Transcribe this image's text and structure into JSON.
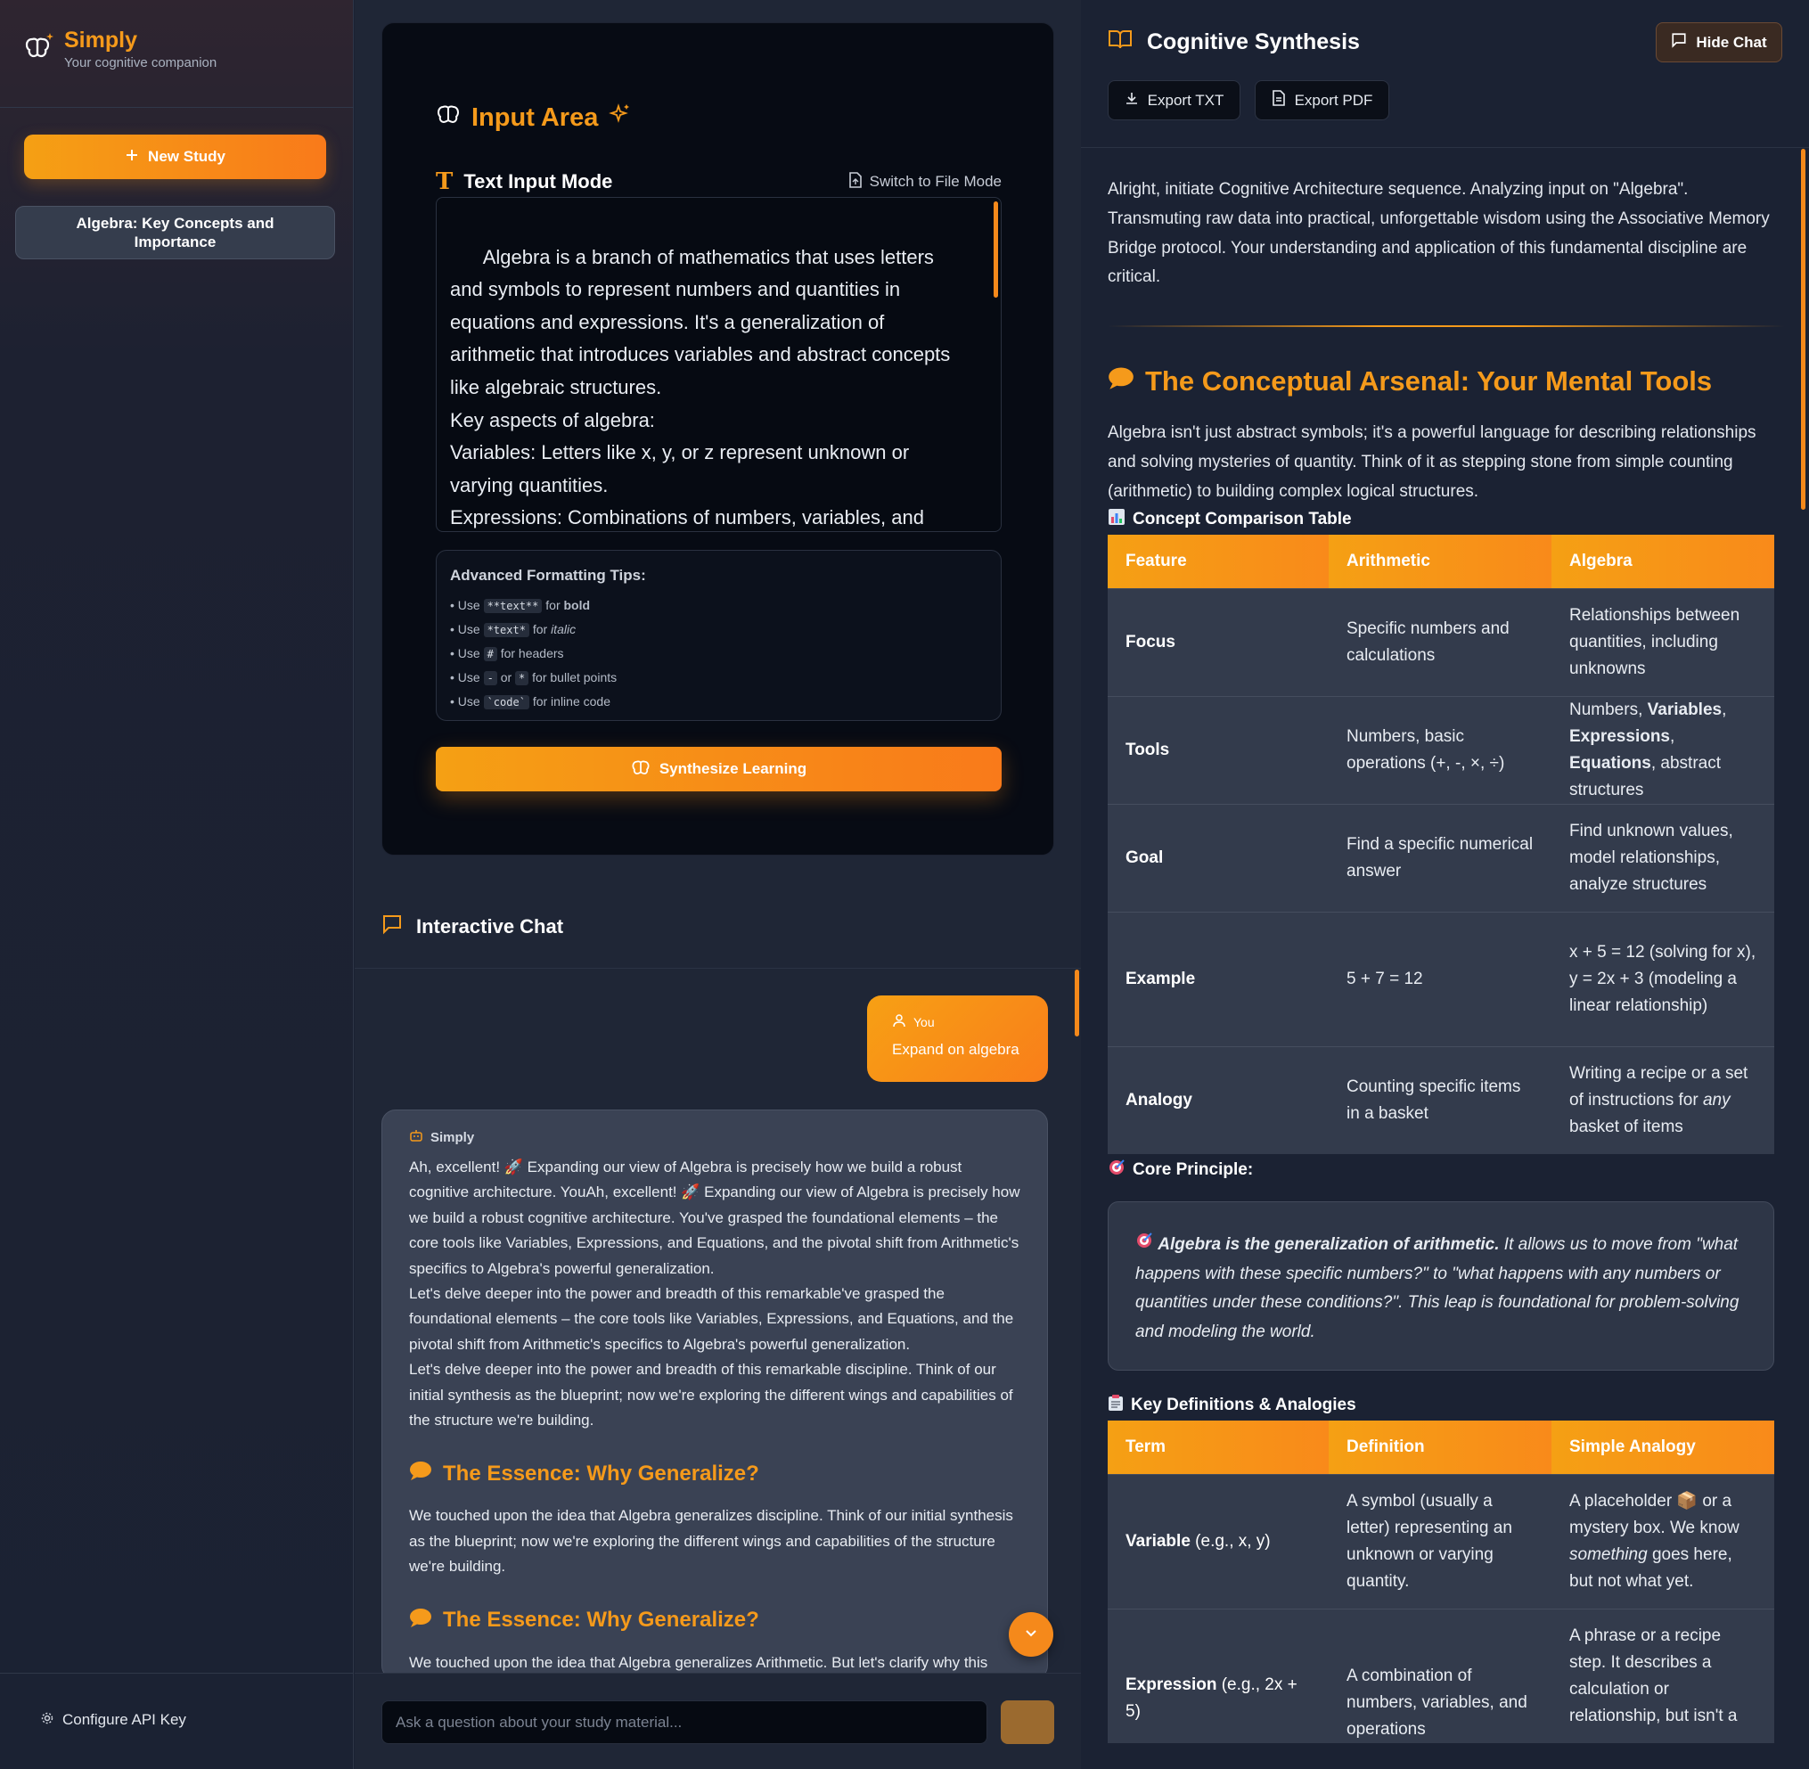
{
  "sidebar": {
    "app_name": "Simply",
    "tagline": "Your cognitive companion",
    "new_study": "New Study",
    "study_item": "Algebra: Key Concepts and Importance",
    "config": "Configure API Key"
  },
  "input": {
    "title": "Input Area",
    "mode": "Text Input Mode",
    "switch": "Switch to File Mode",
    "text": "Algebra is a branch of mathematics that uses letters and symbols to represent numbers and quantities in equations and expressions. It's a generalization of arithmetic that introduces variables and abstract concepts like algebraic structures.\nKey aspects of algebra:\nVariables: Letters like x, y, or z represent unknown or varying quantities.\nExpressions: Combinations of numbers, variables, and operations (like addition, subtraction, multiplication, and",
    "tips_title": "Advanced Formatting Tips:",
    "tip1": {
      "pre": "• Use ",
      "code": "**text**",
      "mid": " for ",
      "post": "bold"
    },
    "tip2": {
      "pre": "• Use ",
      "code": "*text*",
      "mid": " for ",
      "post": "italic"
    },
    "tip3": {
      "pre": "• Use ",
      "code": "#",
      "post": " for headers"
    },
    "tip4": {
      "pre": "• Use ",
      "code": "-",
      "mid": " or ",
      "code2": "*",
      "post": " for bullet points"
    },
    "tip5": {
      "pre": "• Use ",
      "code": "`code`",
      "post": " for inline code"
    },
    "synthesize": "Synthesize Learning"
  },
  "chat": {
    "title": "Interactive Chat",
    "you_label": "You",
    "you_msg": "Expand on algebra",
    "bot_label": "Simply",
    "p1": "Ah, excellent! 🚀 Expanding our view of Algebra is precisely how we build a robust cognitive architecture. YouAh, excellent! 🚀 Expanding our view of Algebra is precisely how we build a robust cognitive architecture. You've grasped the foundational elements – the core tools like Variables, Expressions, and Equations, and the pivotal shift from Arithmetic's specifics to Algebra's powerful generalization.",
    "p2": "Let's delve deeper into the power and breadth of this remarkable've grasped the foundational elements – the core tools like Variables, Expressions, and Equations, and the pivotal shift from Arithmetic's specifics to Algebra's powerful generalization.",
    "p3": "Let's delve deeper into the power and breadth of this remarkable discipline. Think of our initial synthesis as the blueprint; now we're exploring the different wings and capabilities of the structure we're building.",
    "h1": "The Essence: Why Generalize?",
    "p4": "We touched upon the idea that Algebra generalizes discipline. Think of our initial synthesis as the blueprint; now we're exploring the different wings and capabilities of the structure we're building.",
    "h2": "The Essence: Why Generalize?",
    "p5": "We touched upon the idea that Algebra generalizes Arithmetic. But let's clarify why this",
    "placeholder": "Ask a question about your study material..."
  },
  "synthesis": {
    "title": "Cognitive Synthesis",
    "hide_chat": "Hide Chat",
    "export_txt": "Export TXT",
    "export_pdf": "Export PDF",
    "intro": "Alright, initiate Cognitive Architecture sequence. Analyzing input on \"Algebra\". Transmuting raw data into practical, unforgettable wisdom using the Associative Memory Bridge protocol. Your understanding and application of this fundamental discipline are critical.",
    "heading": "The Conceptual Arsenal: Your Mental Tools",
    "para": "Algebra isn't just abstract symbols; it's a powerful language for describing relationships and solving mysteries of quantity. Think of it as stepping stone from simple counting (arithmetic) to building complex logical structures.",
    "table1_label": "Concept Comparison Table",
    "t1_headers": [
      "Feature",
      "Arithmetic",
      "Algebra"
    ],
    "t1_r1": [
      "Focus",
      "Specific numbers and calculations",
      "Relationships between quantities, including unknowns"
    ],
    "t1_r2": {
      "a": "Tools",
      "b": "Numbers, basic operations (+, -, ×, ÷)",
      "c1": "Numbers, ",
      "c2": "Variables",
      "c3": ", ",
      "c4": "Expressions",
      "c5": ", ",
      "c6": "Equations",
      "c7": ", abstract structures"
    },
    "t1_r3": [
      "Goal",
      "Find a specific numerical answer",
      "Find unknown values, model relationships, analyze structures"
    ],
    "t1_r4": [
      "Example",
      "5 + 7 = 12",
      "x + 5 = 12 (solving for x), y = 2x + 3 (modeling a linear relationship)"
    ],
    "t1_r5": {
      "a": "Analogy",
      "b": "Counting specific items in a basket",
      "c1": "Writing a recipe or a set of instructions for ",
      "c2": "any",
      "c3": " basket of items"
    },
    "core_label": "Core Principle:",
    "core_bold": "Algebra is the generalization of arithmetic.",
    "core_rest": " It allows us to move from \"what happens with these specific numbers?\" to \"what happens with any numbers or quantities under these conditions?\". This leap is foundational for problem-solving and modeling the world.",
    "table2_label": "Key Definitions & Analogies",
    "t2_headers": [
      "Term",
      "Definition",
      "Simple Analogy"
    ],
    "t2_r1": {
      "a1": "Variable",
      "a2": " (e.g., x, y)",
      "b": "A symbol (usually a letter) representing an unknown or varying quantity.",
      "c1": "A placeholder 📦 or a mystery box. We know ",
      "c2": "something",
      "c3": " goes here, but not what yet."
    },
    "t2_r2": {
      "a1": "Expression",
      "a2": " (e.g., 2x + 5)",
      "b": "A combination of numbers, variables, and operations",
      "c": "A phrase or a recipe step. It describes a calculation or relationship, but isn't a"
    }
  },
  "colors": {
    "accent": "#f59a1b",
    "panel": "#070b14",
    "bg": "#1b2233"
  }
}
